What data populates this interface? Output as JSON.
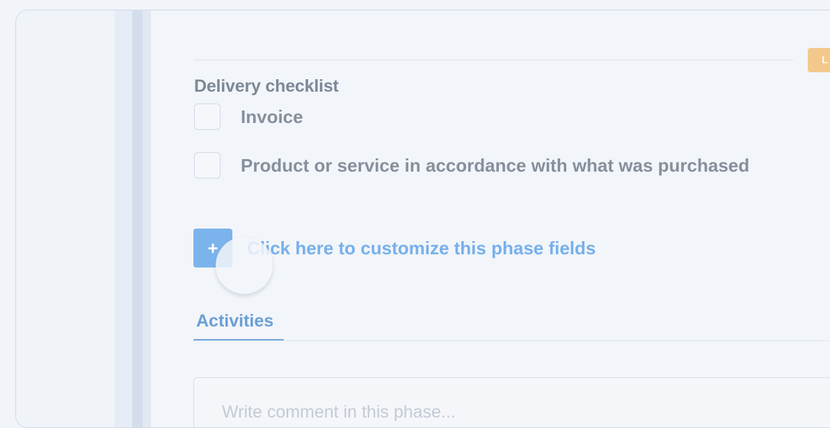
{
  "phase_tag": {
    "label": "L",
    "color": "#f2c98a"
  },
  "checklist": {
    "title": "Delivery checklist",
    "items": [
      {
        "label": "Invoice",
        "checked": false
      },
      {
        "label": "Product or service in accordance with what was purchased",
        "checked": false
      }
    ]
  },
  "customize": {
    "icon": "plus-icon",
    "icon_glyph": "+",
    "label": "Click here to customize this phase fields",
    "accent": "#7cb3ec"
  },
  "tabs": [
    {
      "label": "Activities",
      "active": true
    }
  ],
  "comment": {
    "placeholder": "Write comment in this phase..."
  }
}
